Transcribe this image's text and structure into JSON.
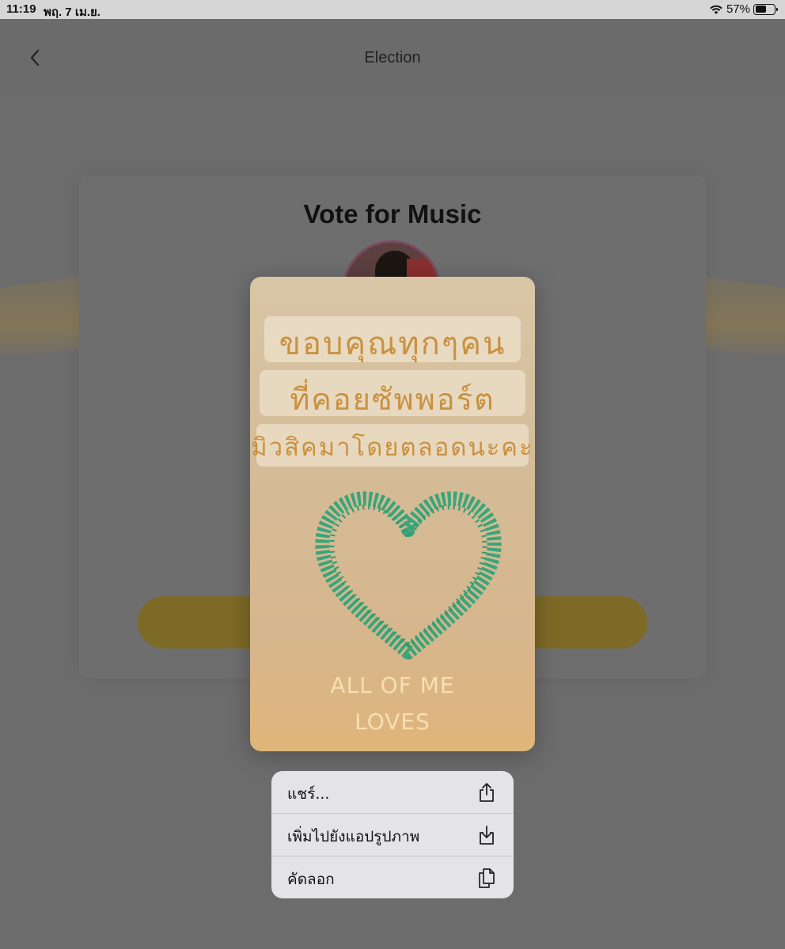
{
  "status_bar": {
    "time": "11:19",
    "date": "พฤ. 7 เม.ย.",
    "battery": "57%"
  },
  "nav": {
    "title": "Election"
  },
  "card": {
    "title": "Vote for Music"
  },
  "preview_image": {
    "thai_lines": [
      "ขอบคุณทุกๆคน",
      "ที่คอยซัพพอร์ต",
      "มิวสิคมาโดยตลอดนะคะ"
    ],
    "english_lines": [
      "ALL OF ME",
      "LOVES"
    ]
  },
  "context_menu": {
    "items": [
      {
        "label": "แชร์...",
        "icon": "share-icon"
      },
      {
        "label": "เพิ่มไปยังแอปรูปภาพ",
        "icon": "save-to-photos-icon"
      },
      {
        "label": "คัดลอก",
        "icon": "copy-icon"
      }
    ]
  },
  "colors": {
    "accent": "#c9913f",
    "heart": "#3aa57a",
    "menu_bg": "#e4e4e6"
  }
}
